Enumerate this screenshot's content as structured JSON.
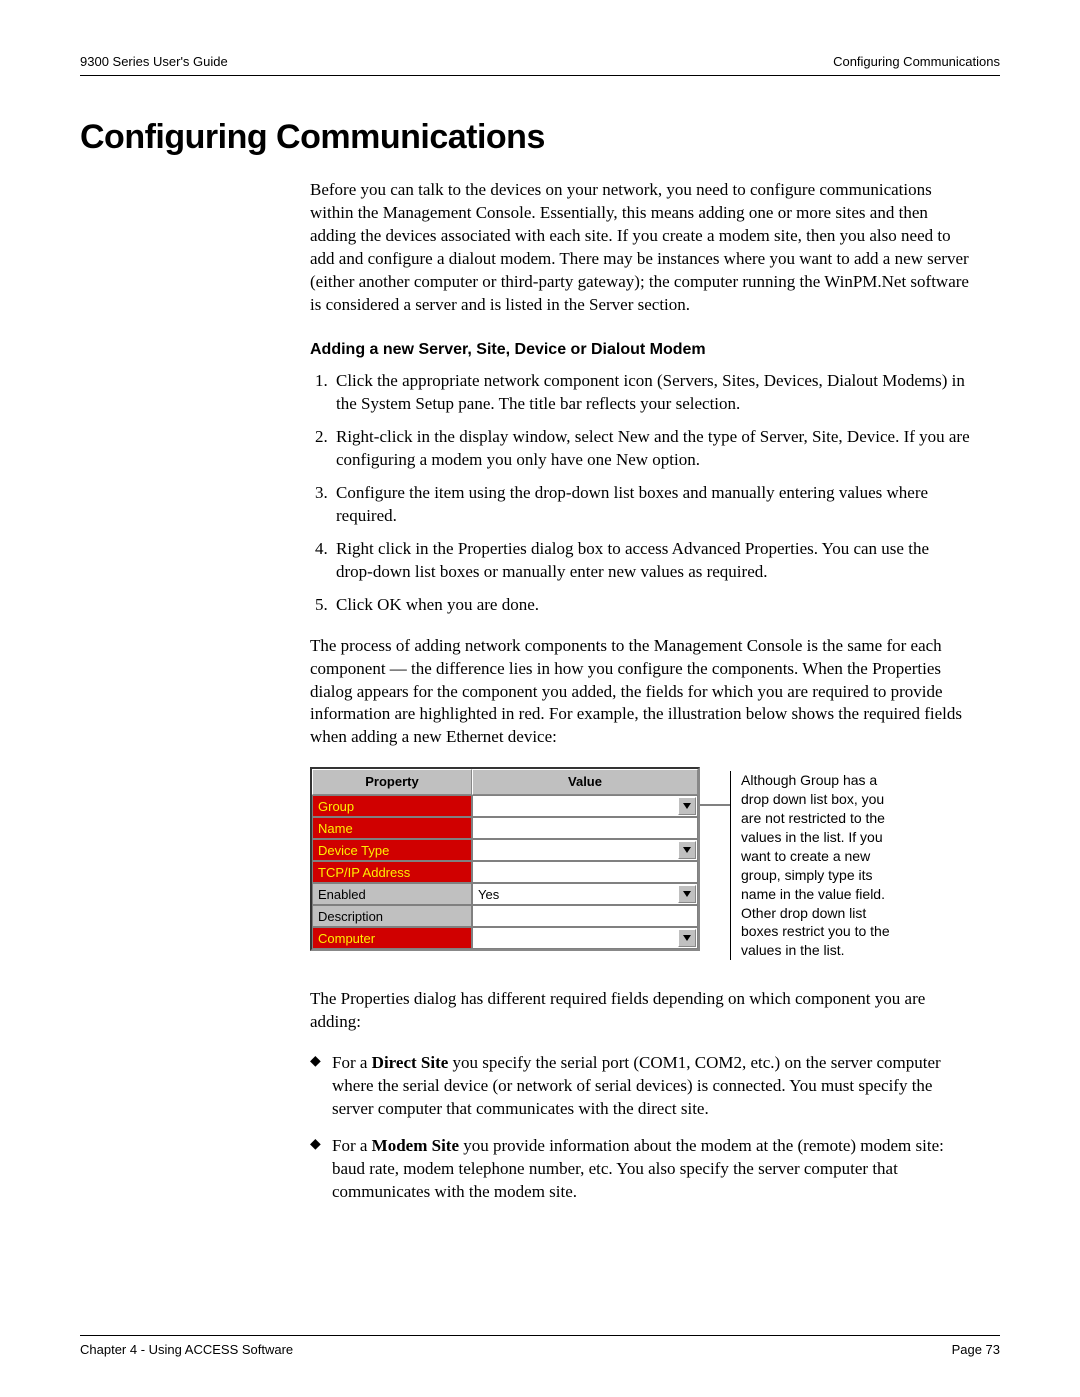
{
  "header": {
    "left": "9300 Series User's Guide",
    "right": "Configuring Communications"
  },
  "title": "Configuring Communications",
  "intro_para": "Before you can talk to the devices on your network, you need to configure communications within the Management Console. Essentially, this means adding one or more sites and then adding the devices associated with each site. If you create a modem site, then you also need to add and configure a dialout modem. There may be instances where you want to add a new server (either another computer or third-party gateway); the computer running the WinPM.Net software is considered a server and is listed in the Server section.",
  "subheading": "Adding a new Server, Site, Device or Dialout Modem",
  "steps": [
    "Click the appropriate network component icon (Servers, Sites, Devices, Dialout Modems) in the System Setup pane. The title bar reflects your selection.",
    "Right-click in the display window, select New and the type of Server, Site, Device. If you are configuring a modem you only have one New option.",
    "Configure the item using the drop-down list boxes and manually entering values where required.",
    "Right click in the Properties dialog box to access Advanced Properties. You can use the drop-down list boxes or manually enter new values as required.",
    "Click OK when you are done."
  ],
  "para2": "The process of adding network components to the Management Console is the same for each component — the difference lies in how you configure the components. When the Properties dialog appears for the component you added, the fields for which you are required to provide information are highlighted in red. For example, the illustration below shows the required fields when adding a new Ethernet device:",
  "table": {
    "head_prop": "Property",
    "head_val": "Value",
    "rows": [
      {
        "label": "Group",
        "value": "",
        "required": true,
        "dropdown": true
      },
      {
        "label": "Name",
        "value": "",
        "required": true,
        "dropdown": false
      },
      {
        "label": "Device Type",
        "value": "",
        "required": true,
        "dropdown": true
      },
      {
        "label": "TCP/IP Address",
        "value": "",
        "required": true,
        "dropdown": false
      },
      {
        "label": "Enabled",
        "value": "Yes",
        "required": false,
        "dropdown": true
      },
      {
        "label": "Description",
        "value": "",
        "required": false,
        "dropdown": false
      },
      {
        "label": "Computer",
        "value": "",
        "required": true,
        "dropdown": true
      }
    ]
  },
  "callout": "Although Group has a drop down list box, you are not restricted to the values in the list. If you want to create a new group, simply type its name in the value field. Other drop down list boxes restrict you to the values in the list.",
  "para3": "The Properties dialog has different required fields depending on which component you are adding:",
  "bullets": [
    {
      "bold": "Direct Site",
      "pre": "For a ",
      "post": " you specify the serial port (COM1, COM2, etc.) on the server computer where the serial device (or network of serial devices) is connected. You must specify the server computer that communicates with the direct site."
    },
    {
      "bold": "Modem Site",
      "pre": "For a ",
      "post": " you provide information about the modem at the (remote) modem site: baud rate, modem telephone number, etc. You also specify the server computer that communicates with the modem site."
    }
  ],
  "footer": {
    "left": "Chapter 4 - Using ACCESS Software",
    "right": "Page 73"
  }
}
